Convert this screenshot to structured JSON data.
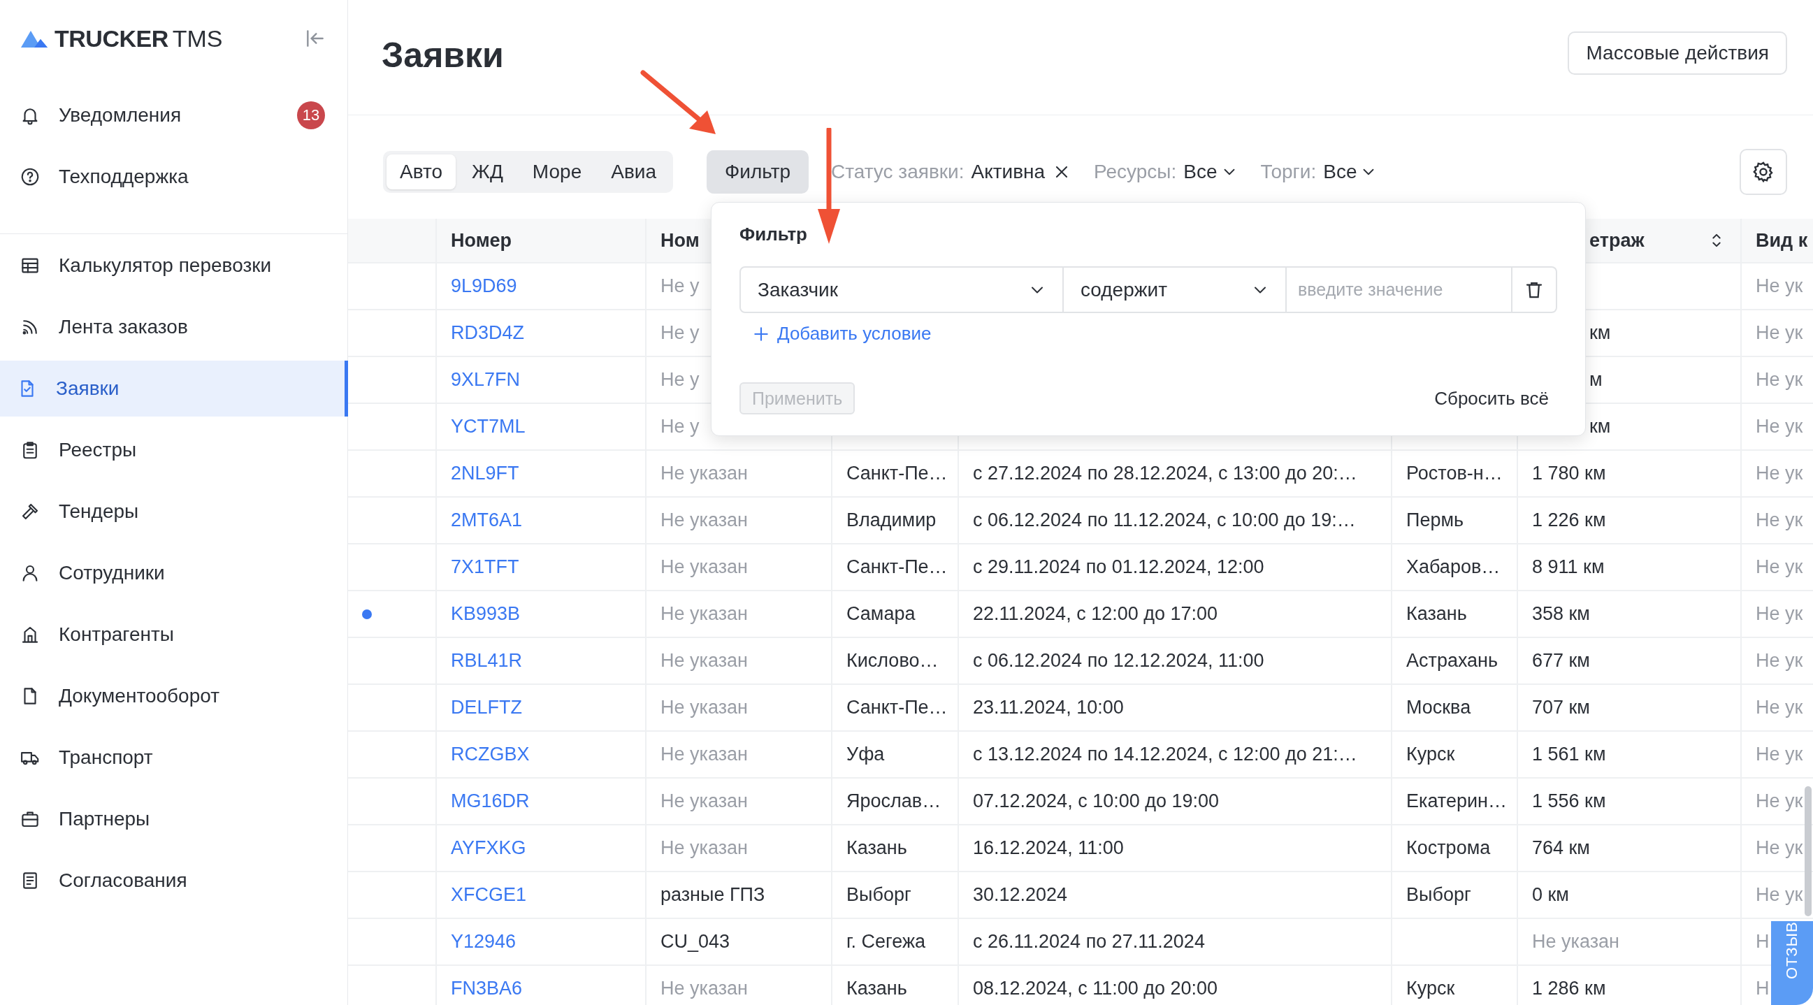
{
  "logo": {
    "brand": "TRUCKER",
    "suffix": "TMS"
  },
  "sidebar": {
    "top_items": [
      {
        "label": "Уведомления",
        "badge": "13",
        "selected": false
      },
      {
        "label": "Техподдержка",
        "selected": false
      }
    ],
    "items": [
      {
        "label": "Калькулятор перевозки",
        "selected": false
      },
      {
        "label": "Лента заказов",
        "selected": false
      },
      {
        "label": "Заявки",
        "selected": true
      },
      {
        "label": "Реестры",
        "selected": false
      },
      {
        "label": "Тендеры",
        "selected": false
      },
      {
        "label": "Сотрудники",
        "selected": false
      },
      {
        "label": "Контрагенты",
        "selected": false
      },
      {
        "label": "Документооборот",
        "selected": false
      },
      {
        "label": "Транспорт",
        "selected": false
      },
      {
        "label": "Партнеры",
        "selected": false
      },
      {
        "label": "Согласования",
        "selected": false
      }
    ]
  },
  "page_title": "Заявки",
  "bulk_button": "Массовые действия",
  "transport_tabs": [
    {
      "label": "Авто",
      "selected": true
    },
    {
      "label": "ЖД",
      "selected": false
    },
    {
      "label": "Море",
      "selected": false
    },
    {
      "label": "Авиа",
      "selected": false
    }
  ],
  "filter_button": {
    "label": "Фильтр",
    "active": true
  },
  "chips": [
    {
      "kind": "clearable",
      "label": "Статус заявки:",
      "value": "Активна"
    },
    {
      "kind": "dropdown",
      "label": "Ресурсы:",
      "value": "Все"
    },
    {
      "kind": "dropdown",
      "label": "Торги:",
      "value": "Все"
    }
  ],
  "filter_popup": {
    "title": "Фильтр",
    "field": "Заказчик",
    "operator": "содержит",
    "placeholder": "введите значение",
    "add_condition": "Добавить условие",
    "apply": {
      "label": "Применить",
      "disabled": true
    },
    "reset": "Сбросить всё"
  },
  "table": {
    "header": {
      "number": "Номер",
      "customer": "Ном",
      "distance": "етраж",
      "column_8": "Вид к"
    },
    "rows": [
      {
        "unread": false,
        "number": "9L9D69",
        "customer": "Не у",
        "customer_muted": true,
        "column_8": "Не ук"
      },
      {
        "unread": false,
        "number": "RD3D4Z",
        "customer": "Не у",
        "customer_muted": true,
        "distance": "км",
        "distance_muted": false,
        "column_8": "Не ук"
      },
      {
        "unread": false,
        "number": "9XL7FN",
        "customer": "Не у",
        "customer_muted": true,
        "distance": "м",
        "distance_muted": false,
        "column_8": "Не ук"
      },
      {
        "unread": false,
        "number": "YCT7ML",
        "customer": "Не у",
        "customer_muted": true,
        "distance": "км",
        "distance_muted": false,
        "column_8": "Не ук"
      },
      {
        "unread": false,
        "number": "2NL9FT",
        "customer": "Не указан",
        "customer_muted": true,
        "origin": "Санкт-Пе…",
        "dates": "с 27.12.2024 по 28.12.2024, с 13:00 до 20:…",
        "destination": "Ростов-н…",
        "distance": "1 780 км",
        "distance_muted": false,
        "column_8": "Не ук"
      },
      {
        "unread": false,
        "number": "2MT6A1",
        "customer": "Не указан",
        "customer_muted": true,
        "origin": "Владимир",
        "dates": "с 06.12.2024 по 11.12.2024, с 10:00 до 19:…",
        "destination": "Пермь",
        "distance": "1 226 км",
        "distance_muted": false,
        "column_8": "Не ук"
      },
      {
        "unread": false,
        "number": "7X1TFT",
        "customer": "Не указан",
        "customer_muted": true,
        "origin": "Санкт-Пе…",
        "dates": "с 29.11.2024 по 01.12.2024, 12:00",
        "destination": "Хабаров…",
        "distance": "8 911 км",
        "distance_muted": false,
        "column_8": "Не ук"
      },
      {
        "unread": true,
        "number": "KB993B",
        "customer": "Не указан",
        "customer_muted": true,
        "origin": "Самара",
        "dates": "22.11.2024, с 12:00 до 17:00",
        "destination": "Казань",
        "distance": "358 км",
        "distance_muted": false,
        "column_8": "Не ук"
      },
      {
        "unread": false,
        "number": "RBL41R",
        "customer": "Не указан",
        "customer_muted": true,
        "origin": "Кислово…",
        "dates": "с 06.12.2024 по 12.12.2024, 11:00",
        "destination": "Астрахань",
        "distance": "677 км",
        "distance_muted": false,
        "column_8": "Не ук"
      },
      {
        "unread": false,
        "number": "DELFTZ",
        "customer": "Не указан",
        "customer_muted": true,
        "origin": "Санкт-Пе…",
        "dates": "23.11.2024, 10:00",
        "destination": "Москва",
        "distance": "707 км",
        "distance_muted": false,
        "column_8": "Не ук"
      },
      {
        "unread": false,
        "number": "RCZGBX",
        "customer": "Не указан",
        "customer_muted": true,
        "origin": "Уфа",
        "dates": "с 13.12.2024 по 14.12.2024, с 12:00 до 21:…",
        "destination": "Курск",
        "distance": "1 561 км",
        "distance_muted": false,
        "column_8": "Не ук"
      },
      {
        "unread": false,
        "number": "MG16DR",
        "customer": "Не указан",
        "customer_muted": true,
        "origin": "Ярослав…",
        "dates": "07.12.2024, с 10:00 до 19:00",
        "destination": "Екатерин…",
        "distance": "1 556 км",
        "distance_muted": false,
        "column_8": "Не ук"
      },
      {
        "unread": false,
        "number": "AYFXKG",
        "customer": "Не указан",
        "customer_muted": true,
        "origin": "Казань",
        "dates": "16.12.2024, 11:00",
        "destination": "Кострома",
        "distance": "764 км",
        "distance_muted": false,
        "column_8": "Не ук"
      },
      {
        "unread": false,
        "number": "XFCGE1",
        "customer": "разные ГПЗ",
        "customer_muted": false,
        "origin": "Выборг",
        "dates": "30.12.2024",
        "destination": "Выборг",
        "distance": "0 км",
        "distance_muted": false,
        "column_8": "Не ук"
      },
      {
        "unread": false,
        "number": "Y12946",
        "customer": "CU_043",
        "customer_muted": false,
        "origin": "г. Сегежа",
        "dates": "с 26.11.2024 по 27.11.2024",
        "distance": "Не указан",
        "distance_muted": true,
        "column_8": "Н"
      },
      {
        "unread": false,
        "number": "FN3BA6",
        "customer": "Не указан",
        "customer_muted": true,
        "origin": "Казань",
        "dates": "08.12.2024, с 11:00 до 20:00",
        "destination": "Курск",
        "distance": "1 286 км",
        "distance_muted": false,
        "column_8": "Н"
      }
    ]
  },
  "feedback_tab": "ОТЗЫВ"
}
